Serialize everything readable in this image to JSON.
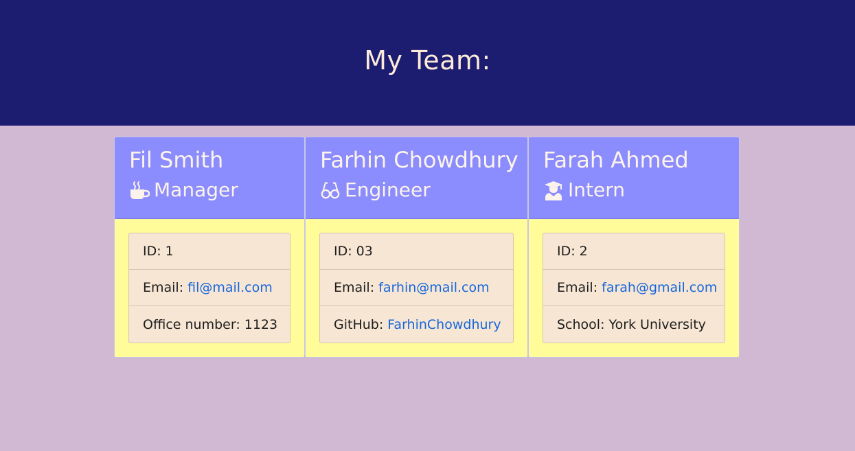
{
  "header": {
    "title": "My Team:"
  },
  "colors": {
    "header_bg": "#1c1c70",
    "page_bg": "#d1b8d3",
    "card_head_bg": "#8b8cfd",
    "card_body_bg": "#fffc99",
    "list_bg": "#f7e6d3",
    "link": "#1466dd"
  },
  "members": [
    {
      "name": "Fil Smith",
      "role": "Manager",
      "role_icon": "coffee-icon",
      "id_label": "ID:",
      "id": "1",
      "email_label": "Email:",
      "email": "fil@mail.com",
      "extra_label": "Office number:",
      "extra": "1123"
    },
    {
      "name": "Farhin Chowdhury",
      "role": "Engineer",
      "role_icon": "glasses-icon",
      "id_label": "ID:",
      "id": "03",
      "email_label": "Email:",
      "email": "farhin@mail.com",
      "extra_label": "GitHub:",
      "extra": "FarhinChowdhury"
    },
    {
      "name": "Farah Ahmed",
      "role": "Intern",
      "role_icon": "graduate-icon",
      "id_label": "ID:",
      "id": "2",
      "email_label": "Email:",
      "email": "farah@gmail.com",
      "extra_label": "School:",
      "extra": "York University"
    }
  ]
}
